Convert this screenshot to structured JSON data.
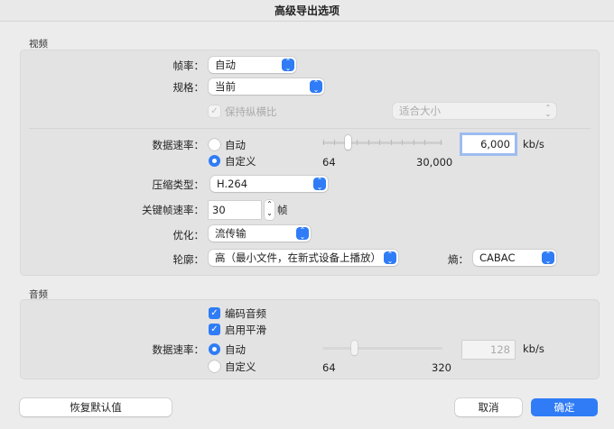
{
  "title": "高级导出选项",
  "video": {
    "section": "视频",
    "frame_rate": {
      "label": "帧率：",
      "value": "自动"
    },
    "size": {
      "label": "规格：",
      "value": "当前"
    },
    "keep_aspect": {
      "label": "保持纵横比",
      "checked": true,
      "enabled": false
    },
    "scale": {
      "value": "适合大小",
      "enabled": false
    },
    "data_rate": {
      "label": "数据速率：",
      "options": [
        "自动",
        "自定义"
      ],
      "selected": "自定义",
      "slider_min": "64",
      "slider_max": "30,000",
      "value": "6,000",
      "unit": "kb/s"
    },
    "compression": {
      "label": "压缩类型：",
      "value": "H.264"
    },
    "keyframe": {
      "label": "关键帧速率：",
      "value": "30",
      "unit": "帧"
    },
    "optimize": {
      "label": "优化：",
      "value": "流传输"
    },
    "profile": {
      "label": "轮廓：",
      "value": "高（最小文件，在新式设备上播放）"
    },
    "entropy": {
      "label": "熵：",
      "value": "CABAC"
    }
  },
  "audio": {
    "section": "音频",
    "encode": {
      "label": "编码音频",
      "checked": true
    },
    "smooth": {
      "label": "启用平滑",
      "checked": true
    },
    "data_rate": {
      "label": "数据速率：",
      "options": [
        "自动",
        "自定义"
      ],
      "selected": "自动",
      "slider_min": "64",
      "slider_max": "320",
      "value": "128",
      "unit": "kb/s"
    }
  },
  "buttons": {
    "restore": "恢复默认值",
    "cancel": "取消",
    "ok": "确定"
  },
  "accent": "#2f7cf6"
}
